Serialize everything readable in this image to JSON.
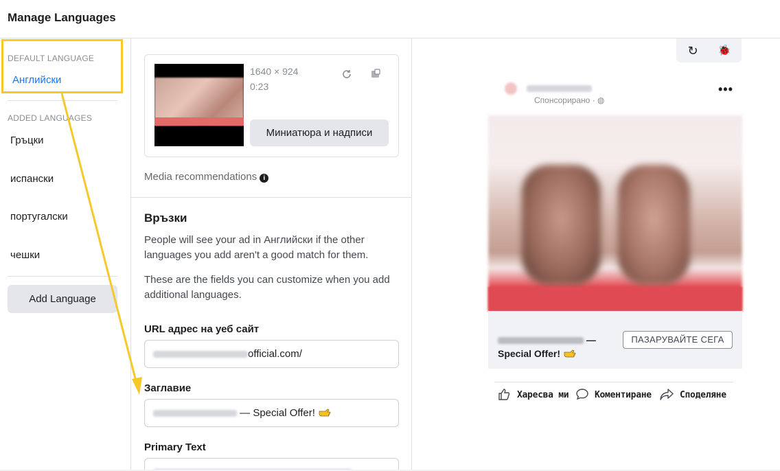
{
  "header": {
    "title": "Manage Languages"
  },
  "sidebar": {
    "default_label": "DEFAULT LANGUAGE",
    "default_language": "Английски",
    "added_label": "ADDED LANGUAGES",
    "languages": [
      "Гръцки",
      "испански",
      "португалски",
      "чешки"
    ],
    "add_button": "Add Language"
  },
  "media": {
    "dimensions": "1640 × 924",
    "duration": "0:23",
    "thumbnail_button": "Миниатюра и надписи",
    "recommendations": "Media recommendations",
    "info_glyph": "i"
  },
  "links": {
    "title": "Връзки",
    "para1": "People will see your ad in Английски if the other languages you add aren't a good match for them.",
    "para2": "These are the fields you can customize when you add additional languages.",
    "url_label": "URL адрес на уеб сайт",
    "url_suffix": "official.com/",
    "headline_label": "Заглавие",
    "headline_value": "— Special Offer!",
    "primary_label": "Primary Text"
  },
  "preview": {
    "sponsored": "Спонсорирано · ◍",
    "more": "•••",
    "headline_dash": "—",
    "headline_offer": "Special Offer!",
    "cta": "ПАЗАРУВАЙТЕ СЕГА",
    "like": "Харесва ми",
    "comment": "Коментиране",
    "share": "Споделяне"
  },
  "tools": {
    "refresh_glyph": "↻",
    "bug_glyph": "🐞"
  },
  "colors": {
    "accent": "#1877f2",
    "highlight": "#f7c82a",
    "cta_red": "#e04b53"
  }
}
